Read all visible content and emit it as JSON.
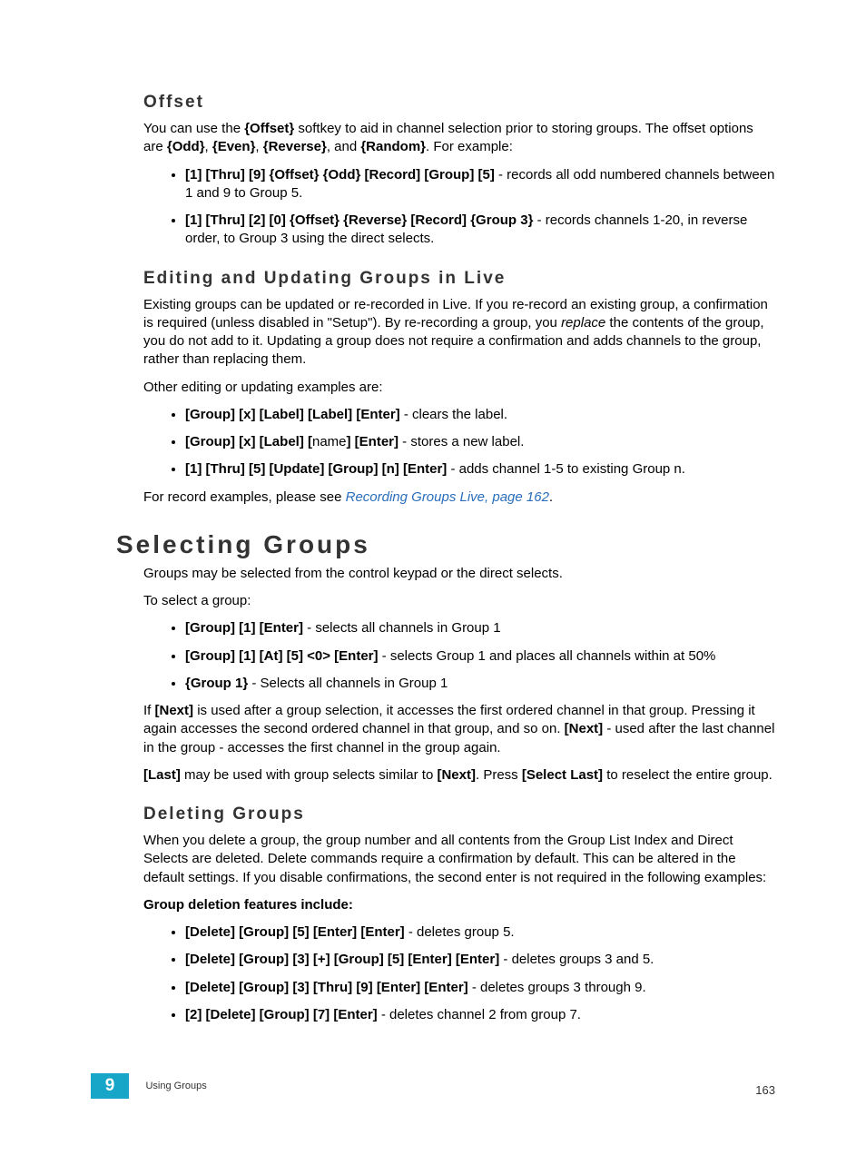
{
  "s1": {
    "title": "Offset"
  },
  "p1a": "You can use the ",
  "p1b": "{Offset}",
  "p1c": " softkey to aid in channel selection prior to storing groups. The offset options are ",
  "p1d": "{Odd}",
  "p1e": ", ",
  "p1f": "{Even}",
  "p1g": ", ",
  "p1h": "{Reverse}",
  "p1i": ", and ",
  "p1j": "{Random}",
  "p1k": ". For example:",
  "li1a": "[1] [Thru] [9] {Offset} {Odd} [Record] [Group] [5]",
  "li1b": " - records all odd numbered channels between 1 and 9 to Group 5.",
  "li2a": "[1] [Thru] [2] [0] {Offset} {Reverse} [Record] {Group 3}",
  "li2b": " - records channels 1-20, in reverse order, to Group 3 using the direct selects.",
  "s2": {
    "title": "Editing and Updating Groups in Live"
  },
  "p2a": "Existing groups can be updated or re-recorded in Live. If you re-record an existing group, a confirmation is required (unless disabled in \"Setup\"). By re-recording a group, you ",
  "p2b": "replace",
  "p2c": " the contents of the group, you do not add to it. Updating a group does not require a confirmation and adds channels to the group, rather than replacing them.",
  "p3": "Other editing or updating examples are:",
  "li3a": "[Group] [x] [Label] [Label] [Enter]",
  "li3b": " - clears the label.",
  "li4a": "[Group] [x] [Label] [",
  "li4b": "name",
  "li4c": "] [Enter]",
  "li4d": " - stores a new label.",
  "li5a": "[1] [Thru] [5] [Update] [Group] [n] [Enter]",
  "li5b": " - adds channel 1-5 to existing Group n.",
  "p4a": "For record examples, please see ",
  "p4b": "Recording Groups Live, page 162",
  "p4c": ".",
  "s3": {
    "title": "Selecting Groups"
  },
  "p5": "Groups may be selected from the control keypad or the direct selects.",
  "p6": "To select a group:",
  "li6a": "[Group] [1] [Enter]",
  "li6b": " - selects all channels in Group 1",
  "li7a": "[Group] [1] [At] [5] <0> [Enter]",
  "li7b": " - selects Group 1 and places all channels within at 50%",
  "li8a": "{Group 1}",
  "li8b": " - Selects all channels in Group 1",
  "p7a": "If ",
  "p7b": "[Next]",
  "p7c": " is used after a group selection, it accesses the first ordered channel in that group. Pressing it again accesses the second ordered channel in that group, and so on. ",
  "p7d": "[Next]",
  "p7e": " - used after the last channel in the group - accesses the first channel in the group again.",
  "p8a": "[Last]",
  "p8b": " may be used with group selects similar to ",
  "p8c": "[Next]",
  "p8d": ". Press ",
  "p8e": "[Select Last]",
  "p8f": " to reselect the entire group.",
  "s4": {
    "title": "Deleting Groups"
  },
  "p9": "When you delete a group, the group number and all contents from the Group List Index and Direct Selects are deleted. Delete commands require a confirmation by default. This can be altered in the default settings. If you disable confirmations, the second enter is not required in the following examples:",
  "p10": "Group deletion features include:",
  "li9a": "[Delete] [Group] [5] [Enter] [Enter]",
  "li9b": " - deletes group 5.",
  "li10a": "[Delete] [Group] [3] [+] [Group] [5] [Enter] [Enter]",
  "li10b": " - deletes groups 3 and 5.",
  "li11a": "[Delete] [Group] [3] [Thru] [9] [Enter] [Enter]",
  "li11b": " - deletes groups 3 through 9.",
  "li12a": "[2] [Delete] [Group] [7] [Enter]",
  "li12b": " - deletes channel 2 from group 7.",
  "footer": {
    "chapter": "9",
    "title": "Using Groups",
    "page": "163"
  }
}
